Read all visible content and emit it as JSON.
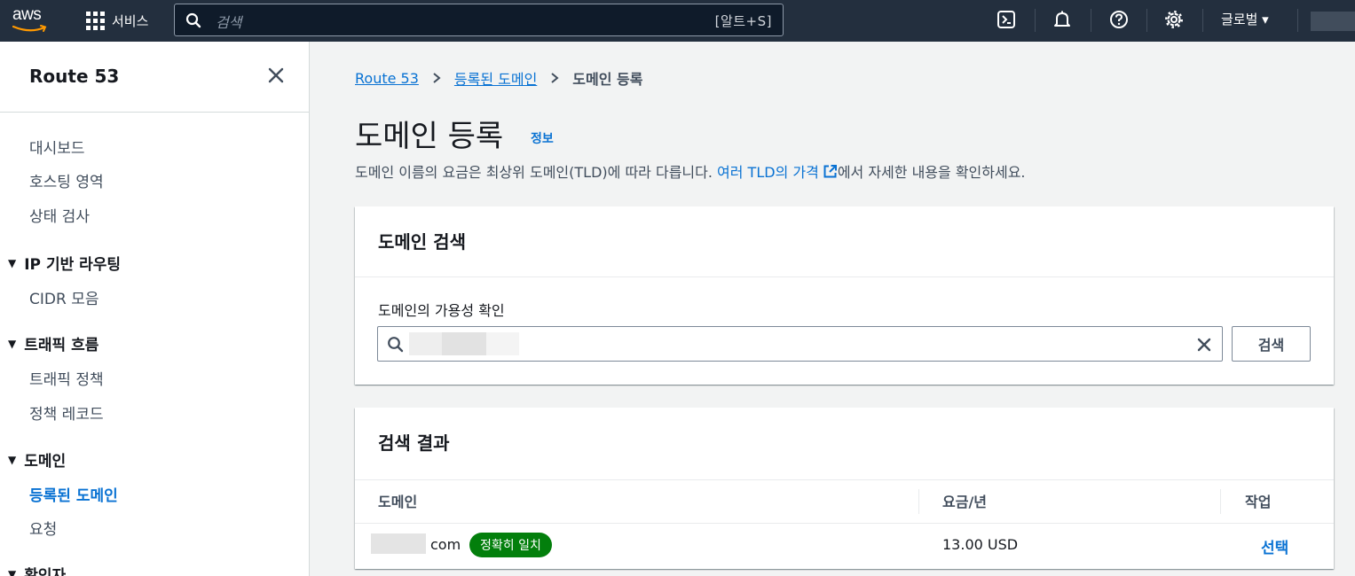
{
  "topnav": {
    "logo_text": "aws",
    "services_label": "서비스",
    "search_placeholder": "검색",
    "search_shortcut": "[알트+S]",
    "region_label": "글로벌 ▾",
    "icons": [
      "cloudshell-icon",
      "bell-icon",
      "help-icon",
      "gear-icon"
    ]
  },
  "sidebar": {
    "title": "Route 53",
    "items": [
      "대시보드",
      "호스팅 영역",
      "상태 검사"
    ],
    "sections": [
      {
        "label": "IP 기반 라우팅",
        "items": [
          "CIDR 모음"
        ]
      },
      {
        "label": "트래픽 흐름",
        "items": [
          "트래픽 정책",
          "정책 레코드"
        ]
      },
      {
        "label": "도메인",
        "items": [
          "등록된 도메인",
          "요청"
        ]
      },
      {
        "label": "확인자",
        "items": []
      }
    ],
    "active_item": "등록된 도메인"
  },
  "breadcrumb": {
    "items": [
      "Route 53",
      "등록된 도메인"
    ],
    "current": "도메인 등록"
  },
  "page": {
    "title": "도메인 등록",
    "info": "정보",
    "desc_before": "도메인 이름의 요금은 최상위 도메인(TLD)에 따라 다릅니다. ",
    "desc_link": "여러 TLD의 가격",
    "desc_after": "에서 자세한 내용을 확인하세요."
  },
  "search_card": {
    "title": "도메인 검색",
    "field_label": "도메인의 가용성 확인",
    "button_label": "검색"
  },
  "results_card": {
    "title": "검색 결과",
    "columns": [
      "도메인",
      "요금/년",
      "작업"
    ],
    "rows": [
      {
        "domain_suffix": "com",
        "badge": "정확히 일치",
        "price": "13.00 USD",
        "action": "선택"
      }
    ]
  },
  "colors": {
    "nav_bg": "#232f3e",
    "link": "#0972d3",
    "badge_bg": "#037f0c",
    "page_bg": "#f2f3f3"
  }
}
